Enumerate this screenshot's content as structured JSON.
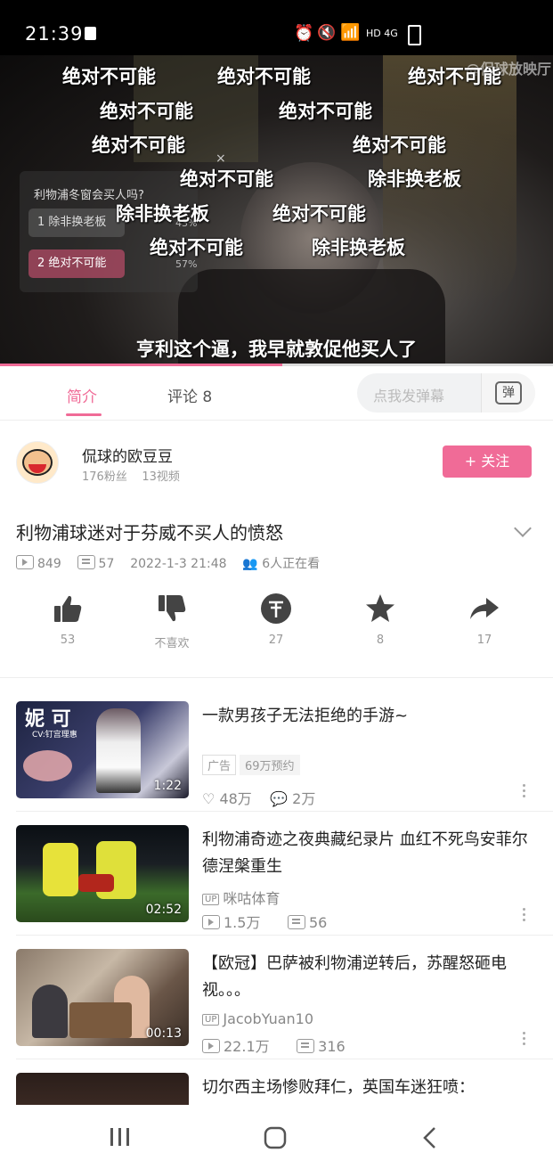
{
  "status_bar": {
    "time": "21:39",
    "net": "HD 4G"
  },
  "video": {
    "watermark": "@保球放映厅",
    "subtitle": "亨利这个逼，我早就敦促他买人了",
    "progress_pct": 51,
    "danmaku": [
      "绝对不可能",
      "绝对不可能",
      "绝对不可能",
      "绝对不可能",
      "绝对不可能",
      "绝对不可能",
      "绝对不可能",
      "绝对不可能",
      "除非换老板",
      "除非换老板",
      "绝对不可能",
      "绝对不可能",
      "除非换老板",
      "绝对不可能"
    ],
    "poll": {
      "question": "利物浦冬窗会买人吗?",
      "options": [
        {
          "label": "1  除非换老板",
          "pct": "43%"
        },
        {
          "label": "2 绝对不可能",
          "pct": "57%"
        }
      ],
      "close": "×"
    }
  },
  "tabs": {
    "intro": "简介",
    "comments": "评论 8",
    "danmu_placeholder": "点我发弹幕",
    "danmu_btn": "弹"
  },
  "author": {
    "name": "侃球的欧豆豆",
    "fans": "176粉丝",
    "videos": "13视频",
    "follow": "+ 关注"
  },
  "video_info": {
    "title": "利物浦球迷对于芬威不买人的愤怒",
    "plays": "849",
    "danmaku": "57",
    "date": "2022-1-3 21:48",
    "watching": "6人正在看"
  },
  "actions": [
    {
      "icon": "thumbs-up-icon",
      "label": "53"
    },
    {
      "icon": "thumbs-down-icon",
      "label": "不喜欢"
    },
    {
      "icon": "coin-icon",
      "label": "27"
    },
    {
      "icon": "star-icon",
      "label": "8"
    },
    {
      "icon": "share-icon",
      "label": "17"
    }
  ],
  "recommendations": [
    {
      "title": "一款男孩子无法拒绝的手游~",
      "thumb_text": "妮 可",
      "thumb_sub": "CV:钉宫理惠",
      "duration": "1:22",
      "tags": [
        "广告",
        "69万预约"
      ],
      "likes": "48万",
      "comments": "2万"
    },
    {
      "title": "利物浦奇迹之夜典藏纪录片 血红不死鸟安菲尔德涅槃重生",
      "uploader": "咪咕体育",
      "duration": "02:52",
      "plays": "1.5万",
      "danmaku": "56"
    },
    {
      "title": "【欧冠】巴萨被利物浦逆转后，苏醒怒砸电视。。。",
      "uploader": "JacobYuan10",
      "duration": "00:13",
      "plays": "22.1万",
      "danmaku": "316"
    },
    {
      "title": "切尔西主场惨败拜仁，英国车迷狂喷："
    }
  ]
}
